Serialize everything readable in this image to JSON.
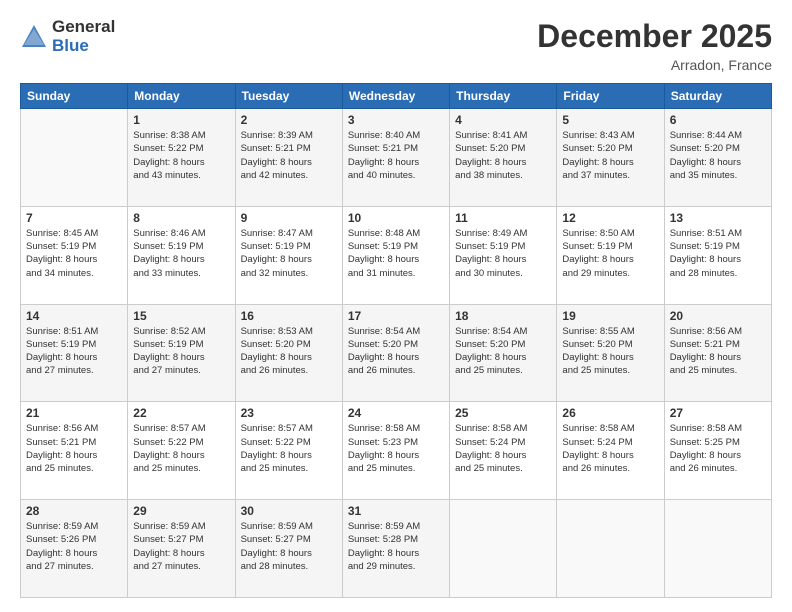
{
  "header": {
    "logo_general": "General",
    "logo_blue": "Blue",
    "month_title": "December 2025",
    "location": "Arradon, France"
  },
  "calendar": {
    "days_of_week": [
      "Sunday",
      "Monday",
      "Tuesday",
      "Wednesday",
      "Thursday",
      "Friday",
      "Saturday"
    ],
    "weeks": [
      [
        {
          "day": "",
          "info": ""
        },
        {
          "day": "1",
          "info": "Sunrise: 8:38 AM\nSunset: 5:22 PM\nDaylight: 8 hours\nand 43 minutes."
        },
        {
          "day": "2",
          "info": "Sunrise: 8:39 AM\nSunset: 5:21 PM\nDaylight: 8 hours\nand 42 minutes."
        },
        {
          "day": "3",
          "info": "Sunrise: 8:40 AM\nSunset: 5:21 PM\nDaylight: 8 hours\nand 40 minutes."
        },
        {
          "day": "4",
          "info": "Sunrise: 8:41 AM\nSunset: 5:20 PM\nDaylight: 8 hours\nand 38 minutes."
        },
        {
          "day": "5",
          "info": "Sunrise: 8:43 AM\nSunset: 5:20 PM\nDaylight: 8 hours\nand 37 minutes."
        },
        {
          "day": "6",
          "info": "Sunrise: 8:44 AM\nSunset: 5:20 PM\nDaylight: 8 hours\nand 35 minutes."
        }
      ],
      [
        {
          "day": "7",
          "info": "Sunrise: 8:45 AM\nSunset: 5:19 PM\nDaylight: 8 hours\nand 34 minutes."
        },
        {
          "day": "8",
          "info": "Sunrise: 8:46 AM\nSunset: 5:19 PM\nDaylight: 8 hours\nand 33 minutes."
        },
        {
          "day": "9",
          "info": "Sunrise: 8:47 AM\nSunset: 5:19 PM\nDaylight: 8 hours\nand 32 minutes."
        },
        {
          "day": "10",
          "info": "Sunrise: 8:48 AM\nSunset: 5:19 PM\nDaylight: 8 hours\nand 31 minutes."
        },
        {
          "day": "11",
          "info": "Sunrise: 8:49 AM\nSunset: 5:19 PM\nDaylight: 8 hours\nand 30 minutes."
        },
        {
          "day": "12",
          "info": "Sunrise: 8:50 AM\nSunset: 5:19 PM\nDaylight: 8 hours\nand 29 minutes."
        },
        {
          "day": "13",
          "info": "Sunrise: 8:51 AM\nSunset: 5:19 PM\nDaylight: 8 hours\nand 28 minutes."
        }
      ],
      [
        {
          "day": "14",
          "info": "Sunrise: 8:51 AM\nSunset: 5:19 PM\nDaylight: 8 hours\nand 27 minutes."
        },
        {
          "day": "15",
          "info": "Sunrise: 8:52 AM\nSunset: 5:19 PM\nDaylight: 8 hours\nand 27 minutes."
        },
        {
          "day": "16",
          "info": "Sunrise: 8:53 AM\nSunset: 5:20 PM\nDaylight: 8 hours\nand 26 minutes."
        },
        {
          "day": "17",
          "info": "Sunrise: 8:54 AM\nSunset: 5:20 PM\nDaylight: 8 hours\nand 26 minutes."
        },
        {
          "day": "18",
          "info": "Sunrise: 8:54 AM\nSunset: 5:20 PM\nDaylight: 8 hours\nand 25 minutes."
        },
        {
          "day": "19",
          "info": "Sunrise: 8:55 AM\nSunset: 5:20 PM\nDaylight: 8 hours\nand 25 minutes."
        },
        {
          "day": "20",
          "info": "Sunrise: 8:56 AM\nSunset: 5:21 PM\nDaylight: 8 hours\nand 25 minutes."
        }
      ],
      [
        {
          "day": "21",
          "info": "Sunrise: 8:56 AM\nSunset: 5:21 PM\nDaylight: 8 hours\nand 25 minutes."
        },
        {
          "day": "22",
          "info": "Sunrise: 8:57 AM\nSunset: 5:22 PM\nDaylight: 8 hours\nand 25 minutes."
        },
        {
          "day": "23",
          "info": "Sunrise: 8:57 AM\nSunset: 5:22 PM\nDaylight: 8 hours\nand 25 minutes."
        },
        {
          "day": "24",
          "info": "Sunrise: 8:58 AM\nSunset: 5:23 PM\nDaylight: 8 hours\nand 25 minutes."
        },
        {
          "day": "25",
          "info": "Sunrise: 8:58 AM\nSunset: 5:24 PM\nDaylight: 8 hours\nand 25 minutes."
        },
        {
          "day": "26",
          "info": "Sunrise: 8:58 AM\nSunset: 5:24 PM\nDaylight: 8 hours\nand 26 minutes."
        },
        {
          "day": "27",
          "info": "Sunrise: 8:58 AM\nSunset: 5:25 PM\nDaylight: 8 hours\nand 26 minutes."
        }
      ],
      [
        {
          "day": "28",
          "info": "Sunrise: 8:59 AM\nSunset: 5:26 PM\nDaylight: 8 hours\nand 27 minutes."
        },
        {
          "day": "29",
          "info": "Sunrise: 8:59 AM\nSunset: 5:27 PM\nDaylight: 8 hours\nand 27 minutes."
        },
        {
          "day": "30",
          "info": "Sunrise: 8:59 AM\nSunset: 5:27 PM\nDaylight: 8 hours\nand 28 minutes."
        },
        {
          "day": "31",
          "info": "Sunrise: 8:59 AM\nSunset: 5:28 PM\nDaylight: 8 hours\nand 29 minutes."
        },
        {
          "day": "",
          "info": ""
        },
        {
          "day": "",
          "info": ""
        },
        {
          "day": "",
          "info": ""
        }
      ]
    ]
  }
}
